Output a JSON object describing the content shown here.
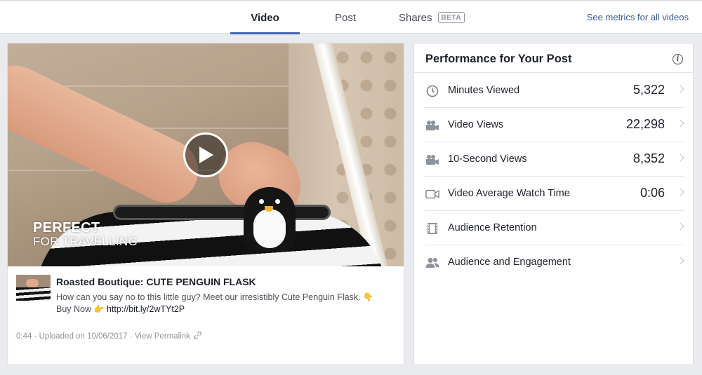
{
  "tabs": [
    {
      "label": "Video",
      "active": true
    },
    {
      "label": "Post",
      "active": false
    },
    {
      "label": "Shares",
      "active": false,
      "badge": "BETA"
    }
  ],
  "see_all_link": "See metrics for all videos",
  "video": {
    "overlay_line1": "PERFECT",
    "overlay_line2": "FOR TRAVELLING",
    "post_title": "Roasted Boutique: CUTE PENGUIN FLASK",
    "post_text": "How can you say no to this little guy? Meet our irresistibly Cute Penguin Flask.",
    "post_text_cta": "Buy Now",
    "post_link": "http://bit.ly/2wTYt2P",
    "duration": "0:44",
    "uploaded": "Uploaded on 10/06/2017",
    "permalink": "View Permalink"
  },
  "performance": {
    "title": "Performance for Your Post",
    "metrics": [
      {
        "label": "Minutes Viewed",
        "value": "5,322",
        "icon": "clock-icon"
      },
      {
        "label": "Video Views",
        "value": "22,298",
        "icon": "video-camera-icon"
      },
      {
        "label": "10-Second Views",
        "value": "8,352",
        "icon": "video-camera-icon"
      },
      {
        "label": "Video Average Watch Time",
        "value": "0:06",
        "icon": "video-icon"
      },
      {
        "label": "Audience Retention",
        "value": "",
        "icon": "film-icon"
      },
      {
        "label": "Audience and Engagement",
        "value": "",
        "icon": "people-icon"
      }
    ]
  },
  "colors": {
    "accent": "#4267b2",
    "link": "#365899",
    "background": "#e9ebee"
  }
}
